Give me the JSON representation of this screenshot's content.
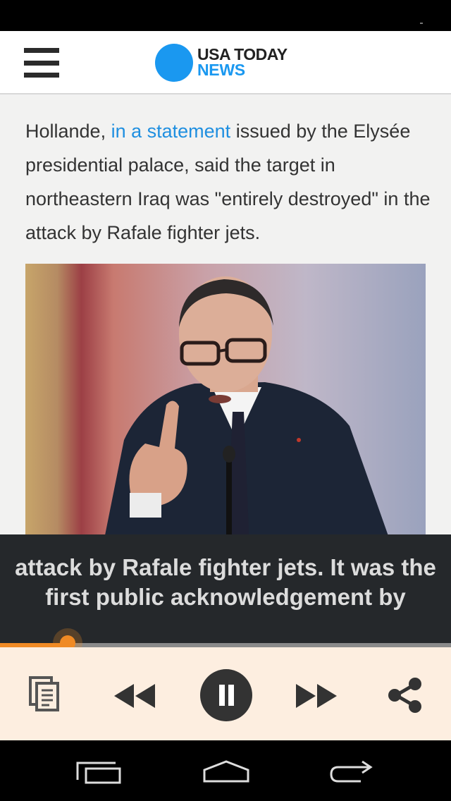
{
  "header": {
    "logo_line1": "USA TODAY",
    "logo_line2": "NEWS",
    "brand_color": "#1a98f0"
  },
  "article": {
    "text_before_link": "Hollande, ",
    "link_text": "in a statement",
    "text_after_link": " issued by the Elysée presidential palace, said the target in northeastern Iraq was \"entirely destroyed\" in the attack by Rafale fighter jets.",
    "link_color": "#1f8fe0"
  },
  "tts": {
    "caption": "attack by Rafale fighter jets.  It was the first public acknowledgement by",
    "progress_percent": 15,
    "accent_color": "#f08a24"
  },
  "player": {
    "buttons": [
      "document-icon",
      "rewind-icon",
      "pause-icon",
      "fast-forward-icon",
      "share-icon"
    ]
  },
  "navigation": {
    "buttons": [
      "recent-apps-icon",
      "home-icon",
      "back-icon"
    ]
  }
}
